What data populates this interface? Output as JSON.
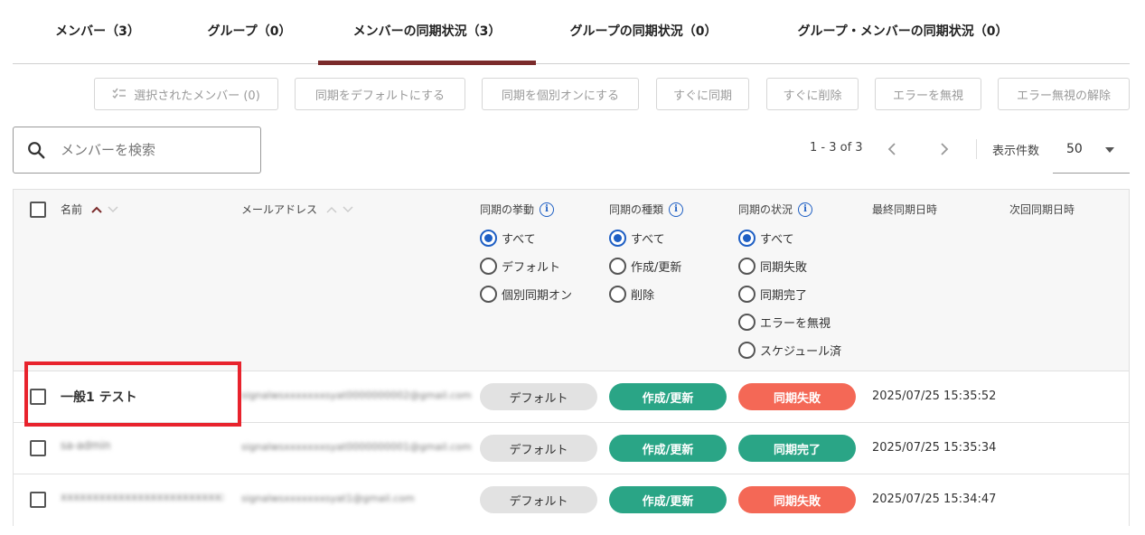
{
  "tabs": [
    {
      "label": "メンバー（3）"
    },
    {
      "label": "グループ（0）"
    },
    {
      "label": "メンバーの同期状況（3）",
      "active": true
    },
    {
      "label": "グループの同期状況（0）"
    },
    {
      "label": "グループ・メンバーの同期状況（0）"
    }
  ],
  "toolbar": {
    "selected_members": "選択されたメンバー (0)",
    "sync_default": "同期をデフォルトにする",
    "sync_individual_on": "同期を個別オンにする",
    "sync_now": "すぐに同期",
    "delete_now": "すぐに削除",
    "ignore_error": "エラーを無視",
    "unignore_error": "エラー無視の解除"
  },
  "search": {
    "placeholder": "メンバーを検索",
    "value": ""
  },
  "pagination": {
    "range": "1 - 3 of 3",
    "per_page_label": "表示件数",
    "per_page_value": "50"
  },
  "columns": {
    "name": "名前",
    "email": "メールアドレス",
    "sync_behavior": "同期の挙動",
    "sync_type": "同期の種類",
    "sync_status": "同期の状況",
    "last_sync": "最終同期日時",
    "next_sync": "次回同期日時"
  },
  "filters": {
    "sync_behavior": [
      "すべて",
      "デフォルト",
      "個別同期オン"
    ],
    "sync_type": [
      "すべて",
      "作成/更新",
      "削除"
    ],
    "sync_status": [
      "すべて",
      "同期失敗",
      "同期完了",
      "エラーを無視",
      "スケジュール済"
    ]
  },
  "rows": [
    {
      "name": "一般1 テスト",
      "email": "signalwsxxxxxxxsyat0000000002@gmail.com",
      "behavior": "デフォルト",
      "type": "作成/更新",
      "status": "同期失敗",
      "status_color": "#f46856",
      "last_sync": "2025/07/25 15:35:52"
    },
    {
      "name": "sa-admin",
      "email": "signalwsxxxxxxxsyat0000000001@gmail.com",
      "behavior": "デフォルト",
      "type": "作成/更新",
      "status": "同期完了",
      "status_color": "#2aa586",
      "last_sync": "2025/07/25 15:35:34"
    },
    {
      "name": "xxxxxxxxxxxxxxxxxxxxxxxxxxxx",
      "email": "signalwsxxxxxxxsyat1@gmail.com",
      "behavior": "デフォルト",
      "type": "作成/更新",
      "status": "同期失敗",
      "status_color": "#f46856",
      "last_sync": "2025/07/25 15:34:47"
    }
  ],
  "colors": {
    "accent": "#7b2b2b",
    "radio": "#1e5fc4",
    "highlight": "#e8232d"
  }
}
